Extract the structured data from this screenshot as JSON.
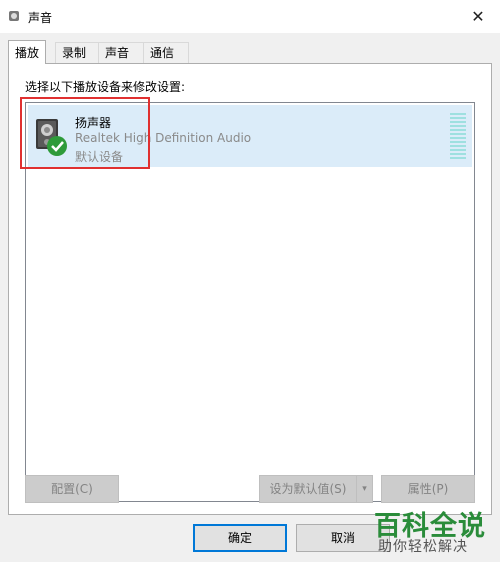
{
  "window": {
    "title": "声音",
    "close_glyph": "✕"
  },
  "tabs": [
    {
      "label": "播放",
      "active": true
    },
    {
      "label": "录制",
      "active": false
    },
    {
      "label": "声音",
      "active": false
    },
    {
      "label": "通信",
      "active": false
    }
  ],
  "playback": {
    "instruction": "选择以下播放设备来修改设置:",
    "devices": [
      {
        "name": "扬声器",
        "driver": "Realtek High Definition Audio",
        "status": "默认设备",
        "icon": "speaker-icon",
        "status_icon": "default-check-icon",
        "selected": true
      }
    ]
  },
  "panel_buttons": {
    "configure": "配置(C)",
    "set_default": "设为默认值(S)",
    "set_default_arrow": "▾",
    "properties": "属性(P)"
  },
  "dialog_buttons": {
    "ok": "确定",
    "cancel": "取消"
  },
  "watermark": {
    "title": "百科全说",
    "subtitle": "助你轻松解决"
  },
  "colors": {
    "selection": "#dbecf9",
    "accent": "#0078d7",
    "annotation_box": "#e03030",
    "check_badge": "#2e9b3a"
  }
}
